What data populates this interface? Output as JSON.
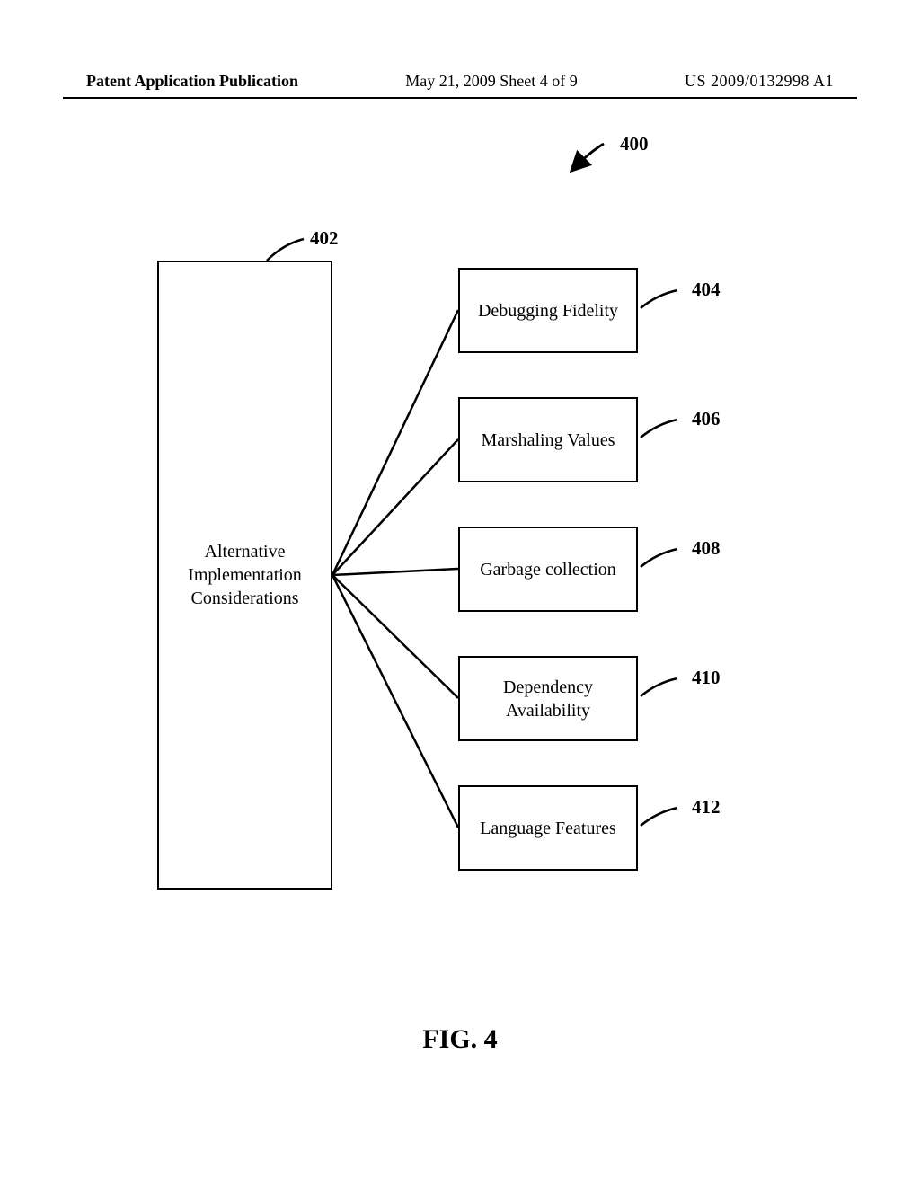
{
  "header": {
    "left": "Patent Application Publication",
    "center": "May 21, 2009  Sheet 4 of 9",
    "right": "US 2009/0132998 A1"
  },
  "figure_caption": "FIG. 4",
  "ref_numbers": {
    "overall": "400",
    "main_box": "402",
    "box1": "404",
    "box2": "406",
    "box3": "408",
    "box4": "410",
    "box5": "412"
  },
  "boxes": {
    "main": "Alternative\nImplementation\nConsiderations",
    "b404": "Debugging Fidelity",
    "b406": "Marshaling Values",
    "b408": "Garbage collection",
    "b410": "Dependency\nAvailability",
    "b412": "Language Features"
  }
}
